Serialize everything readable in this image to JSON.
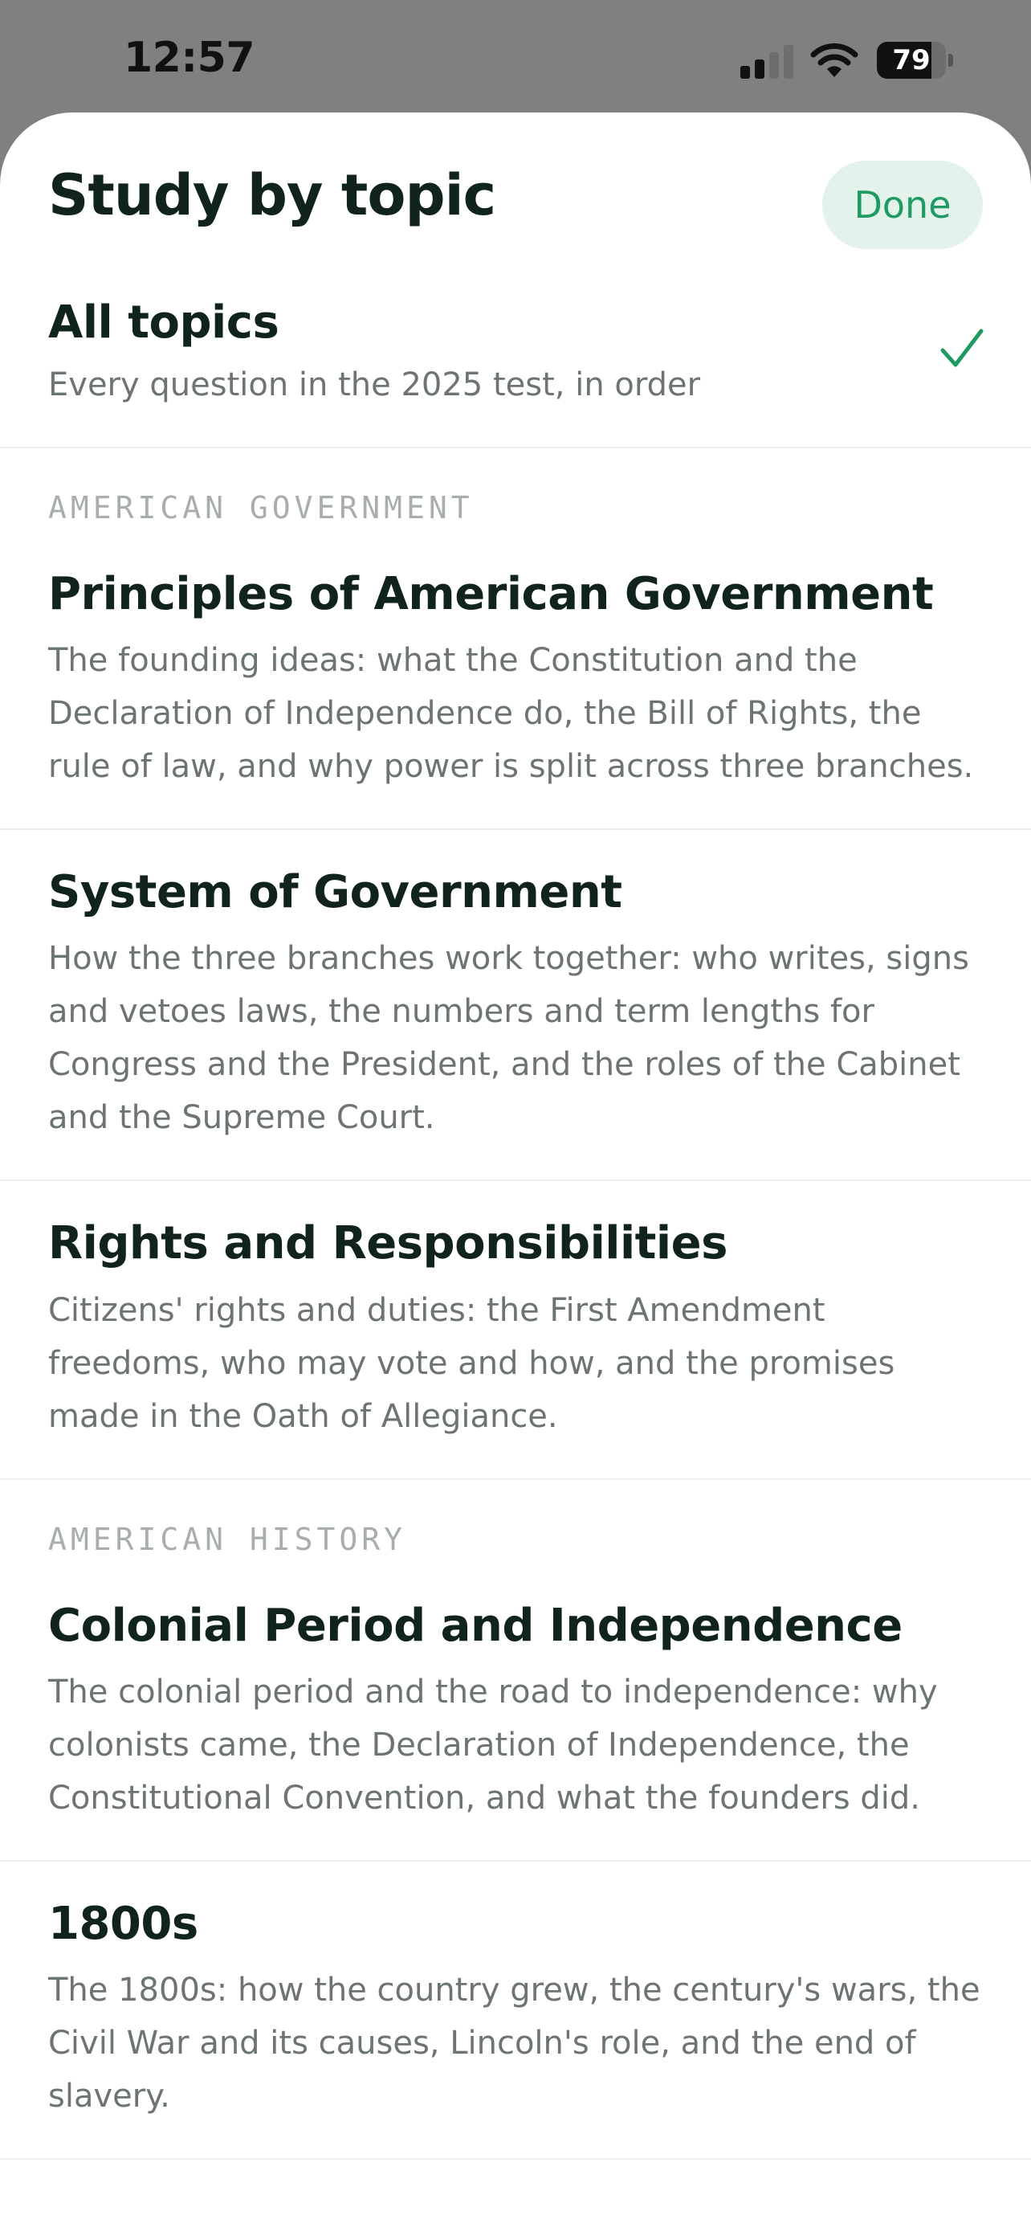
{
  "status_bar": {
    "time": "12:57",
    "battery_level": "79",
    "battery_fraction": 0.79,
    "icons": [
      "signal-icon",
      "wifi-icon",
      "battery-icon"
    ]
  },
  "sheet": {
    "title": "Study by topic",
    "done_label": "Done"
  },
  "all_topics": {
    "title": "All topics",
    "subtitle": "Every question in the 2025 test, in order",
    "selected": true,
    "check_icon": "checkmark-icon"
  },
  "sections": [
    {
      "header": "AMERICAN GOVERNMENT",
      "topics": [
        {
          "title": "Principles of American Government",
          "description": "The founding ideas: what the Constitution and the Declaration of Independence do, the Bill of Rights, the rule of law, and why power is split across three branches."
        },
        {
          "title": "System of Government",
          "description": "How the three branches work together: who writes, signs and vetoes laws, the numbers and term lengths for Congress and the President, and the roles of the Cabinet and the Supreme Court."
        },
        {
          "title": "Rights and Responsibilities",
          "description": "Citizens' rights and duties: the First Amendment freedoms, who may vote and how, and the promises made in the Oath of Allegiance."
        }
      ]
    },
    {
      "header": "AMERICAN HISTORY",
      "topics": [
        {
          "title": "Colonial Period and Independence",
          "description": "The colonial period and the road to independence: why colonists came, the Declaration of Independence, the Constitutional Convention, and what the founders did."
        },
        {
          "title": "1800s",
          "description": "The 1800s: how the country grew, the century's wars, the Civil War and its causes, Lincoln's role, and the end of slavery."
        }
      ]
    }
  ],
  "colors": {
    "accent": "#1f9a63",
    "done_bg": "#e3f2ea",
    "title_text": "#10231c",
    "sub_text": "#6d7570",
    "section_text": "#a8afab",
    "backdrop": "#808080"
  }
}
